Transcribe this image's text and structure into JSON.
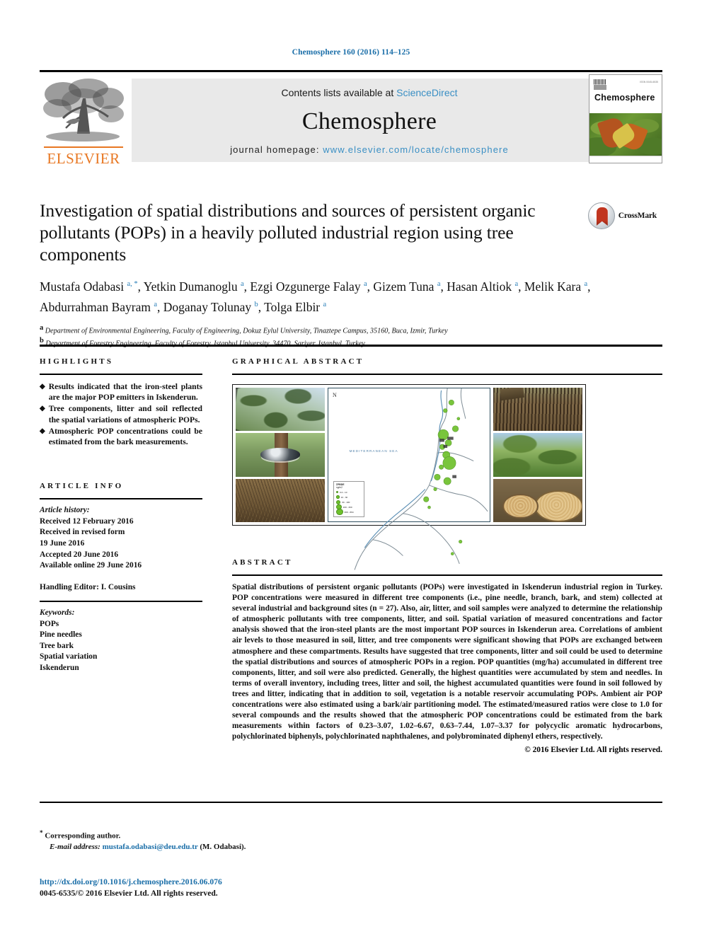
{
  "running_head": "Chemosphere 160 (2016) 114–125",
  "masthead": {
    "publisher": "ELSEVIER",
    "contents_prefix": "Contents lists available at ",
    "sciencedirect": "ScienceDirect",
    "journal_name": "Chemosphere",
    "homepage_prefix": "journal homepage: ",
    "homepage_url": "www.elsevier.com/locate/chemosphere",
    "cover_title": "Chemosphere",
    "cover_corner_text": "ISSN 0045-6535"
  },
  "article": {
    "title": "Investigation of spatial distributions and sources of persistent organic pollutants (POPs) in a heavily polluted industrial region using tree components",
    "crossmark_label": "CrossMark",
    "authors": [
      {
        "name": "Mustafa Odabasi",
        "marks": "a, *"
      },
      {
        "name": "Yetkin Dumanoglu",
        "marks": "a"
      },
      {
        "name": "Ezgi Ozgunerge Falay",
        "marks": "a"
      },
      {
        "name": "Gizem Tuna",
        "marks": "a"
      },
      {
        "name": "Hasan Altiok",
        "marks": "a"
      },
      {
        "name": "Melik Kara",
        "marks": "a"
      },
      {
        "name": "Abdurrahman Bayram",
        "marks": "a"
      },
      {
        "name": "Doganay Tolunay",
        "marks": "b"
      },
      {
        "name": "Tolga Elbir",
        "marks": "a"
      }
    ],
    "affiliations": [
      {
        "mark": "a",
        "text": "Department of Environmental Engineering, Faculty of Engineering, Dokuz Eylul University, Tinaztepe Campus, 35160, Buca, Izmir, Turkey"
      },
      {
        "mark": "b",
        "text": "Department of Forestry Engineering, Faculty of Forestry, Istanbul University, 34470, Sariyer, Istanbul, Turkey"
      }
    ]
  },
  "highlights": {
    "heading": "HIGHLIGHTS",
    "items": [
      "Results indicated that the iron-steel plants are the major POP emitters in Iskenderun.",
      "Tree components, litter and soil reflected the spatial variations of atmospheric POPs.",
      "Atmospheric POP concentrations could be estimated from the bark measurements."
    ]
  },
  "graphical_abstract": {
    "heading": "GRAPHICAL ABSTRACT",
    "map": {
      "sea_label": "MEDITERRANEAN SEA",
      "north_arrow": "N",
      "legend_title": "ΣPBDE",
      "legend_unit": "ng/m2",
      "legend_rows": [
        {
          "label": "0.0 - 10",
          "size": 3
        },
        {
          "label": "10 - 30",
          "size": 4.5
        },
        {
          "label": "30 - 100",
          "size": 6
        },
        {
          "label": "100 - 300",
          "size": 7.5
        },
        {
          "label": "300 - 864",
          "size": 9.5
        }
      ]
    },
    "photos": [
      {
        "name": "pine-canopy-photo"
      },
      {
        "name": "air-sampler-photo"
      },
      {
        "name": "forest-litter-photo"
      },
      {
        "name": "tree-bark-photo"
      },
      {
        "name": "pine-branch-photo"
      },
      {
        "name": "cut-logs-photo"
      }
    ]
  },
  "article_info": {
    "heading": "ARTICLE INFO",
    "history_label": "Article history:",
    "history": [
      "Received 12 February 2016",
      "Received in revised form",
      "19 June 2016",
      "Accepted 20 June 2016",
      "Available online 29 June 2016"
    ],
    "handling_editor": "Handling Editor: I. Cousins",
    "keywords_label": "Keywords:",
    "keywords": [
      "POPs",
      "Pine needles",
      "Tree bark",
      "Spatial variation",
      "Iskenderun"
    ]
  },
  "abstract": {
    "heading": "ABSTRACT",
    "text": "Spatial distributions of persistent organic pollutants (POPs) were investigated in Iskenderun industrial region in Turkey. POP concentrations were measured in different tree components (i.e., pine needle, branch, bark, and stem) collected at several industrial and background sites (n = 27). Also, air, litter, and soil samples were analyzed to determine the relationship of atmospheric pollutants with tree components, litter, and soil. Spatial variation of measured concentrations and factor analysis showed that the iron-steel plants are the most important POP sources in Iskenderun area. Correlations of ambient air levels to those measured in soil, litter, and tree components were significant showing that POPs are exchanged between atmosphere and these compartments. Results have suggested that tree components, litter and soil could be used to determine the spatial distributions and sources of atmospheric POPs in a region. POP quantities (mg/ha) accumulated in different tree components, litter, and soil were also predicted. Generally, the highest quantities were accumulated by stem and needles. In terms of overall inventory, including trees, litter and soil, the highest accumulated quantities were found in soil followed by trees and litter, indicating that in addition to soil, vegetation is a notable reservoir accumulating POPs. Ambient air POP concentrations were also estimated using a bark/air partitioning model. The estimated/measured ratios were close to 1.0 for several compounds and the results showed that the atmospheric POP concentrations could be estimated from the bark measurements within factors of 0.23–3.07, 1.02–6.67, 0.63–7.44, 1.07–3.37 for polycyclic aromatic hydrocarbons, polychlorinated biphenyls, polychlorinated naphthalenes, and polybrominated diphenyl ethers, respectively.",
    "copyright": "© 2016 Elsevier Ltd. All rights reserved."
  },
  "footer": {
    "corresponding_marker": "*",
    "corresponding_label": "Corresponding author.",
    "email_label": "E-mail address:",
    "email": "mustafa.odabasi@deu.edu.tr",
    "email_suffix": "(M. Odabasi).",
    "doi": "http://dx.doi.org/10.1016/j.chemosphere.2016.06.076",
    "issn_line": "0045-6535/© 2016 Elsevier Ltd. All rights reserved."
  },
  "colors": {
    "link": "#1a6ea8",
    "sciencedirect": "#3a8fc4",
    "elsevier_orange": "#E87722",
    "map_green": "#6ec12c",
    "crossmark_red": "#c1351f"
  }
}
